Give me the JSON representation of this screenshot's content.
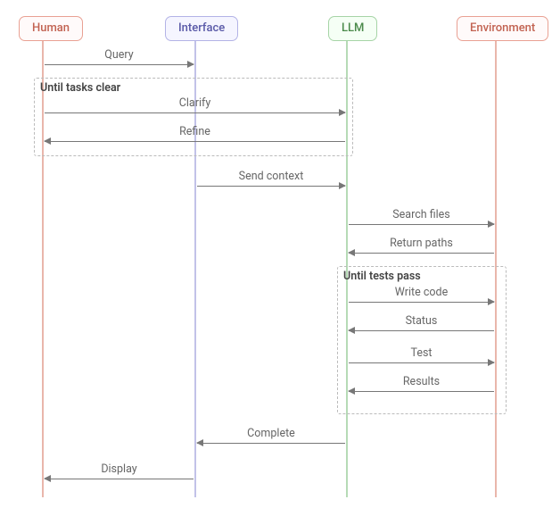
{
  "participants": {
    "human": "Human",
    "interface": "Interface",
    "llm": "LLM",
    "environment": "Environment"
  },
  "loops": {
    "tasks_clear": "Until tasks clear",
    "tests_pass": "Until tests pass"
  },
  "messages": {
    "query": "Query",
    "clarify": "Clarify",
    "refine": "Refine",
    "send_context": "Send context",
    "search_files": "Search files",
    "return_paths": "Return paths",
    "write_code": "Write code",
    "status": "Status",
    "test": "Test",
    "results": "Results",
    "complete": "Complete",
    "display": "Display"
  },
  "lanes_x": {
    "human": 48,
    "interface": 219,
    "llm": 389,
    "environment": 556
  },
  "colors": {
    "human": "#c26352",
    "interface": "#5a5aa8",
    "llm": "#4a8a4a",
    "environment": "#c26352",
    "arrow": "#777777",
    "dashed": "#bbbbbb"
  }
}
